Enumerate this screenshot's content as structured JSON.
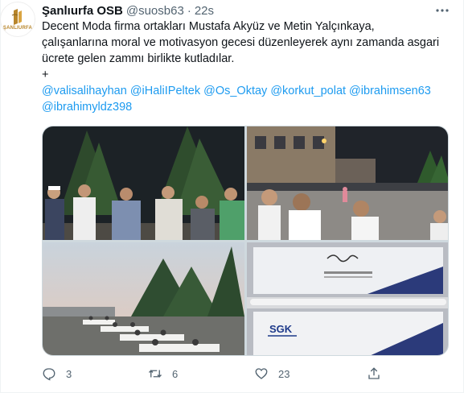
{
  "tweet": {
    "author": {
      "display_name": "Şanlıurfa OSB",
      "handle": "@suosb63",
      "avatar_text": "ŞANLIURFA"
    },
    "separator": "·",
    "time": "22s",
    "more_icon": "more-icon",
    "text_lines": [
      "Decent Moda firma ortakları Mustafa Akyüz ve Metin Yalçınkaya,",
      "çalışanlarına moral ve motivasyon gecesi düzenleyerek aynı zamanda asgari",
      "ücrete gelen zammı birlikte kutladılar.",
      "+"
    ],
    "mention_lines": [
      "@valisalihayhan @iHaliIPeltek @Os_Oktay @korkut_polat @ibrahimsen63",
      "@ibrahimyldz398"
    ],
    "media": {
      "photo_3_text": "",
      "photo_4_labels": [
        "SGK"
      ]
    },
    "actions": {
      "reply": {
        "icon": "reply-icon",
        "count": "3"
      },
      "retweet": {
        "icon": "retweet-icon",
        "count": "6"
      },
      "like": {
        "icon": "heart-icon",
        "count": "23"
      },
      "share": {
        "icon": "share-icon",
        "count": ""
      }
    }
  },
  "colors": {
    "text_primary": "#0f1419",
    "text_secondary": "#536471",
    "link": "#1d9bf0",
    "border": "#cfd9de",
    "brand_gold": "#b8862b"
  }
}
